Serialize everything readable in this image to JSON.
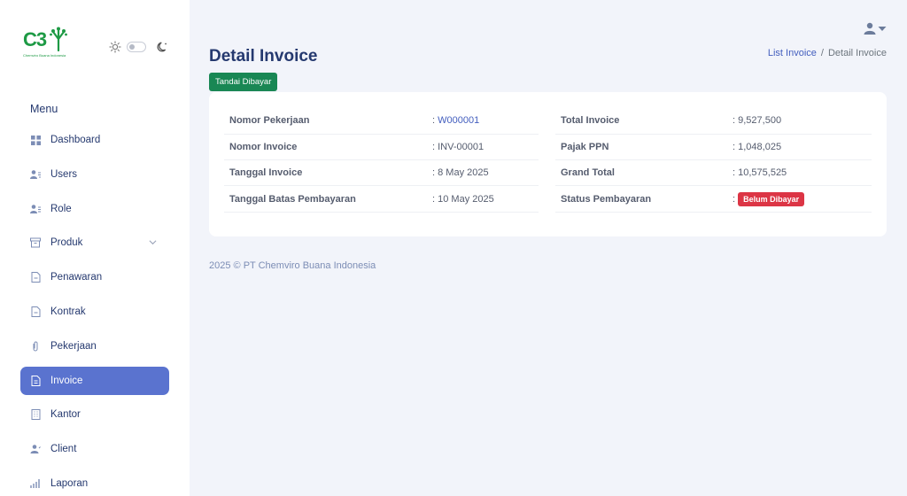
{
  "brand": {
    "logo_text": "C3",
    "tagline": "Chemviro Buana Indonesia"
  },
  "sidebar": {
    "menu_title": "Menu",
    "items": [
      {
        "label": "Dashboard",
        "icon": "grid-icon"
      },
      {
        "label": "Users",
        "icon": "users-icon"
      },
      {
        "label": "Role",
        "icon": "role-icon"
      },
      {
        "label": "Produk",
        "icon": "archive-icon",
        "has_submenu": true
      },
      {
        "label": "Penawaran",
        "icon": "file-icon"
      },
      {
        "label": "Kontrak",
        "icon": "file-minus-icon"
      },
      {
        "label": "Pekerjaan",
        "icon": "paperclip-icon"
      },
      {
        "label": "Invoice",
        "icon": "file-text-icon",
        "active": true
      },
      {
        "label": "Kantor",
        "icon": "building-icon"
      },
      {
        "label": "Client",
        "icon": "person-icon"
      },
      {
        "label": "Laporan",
        "icon": "bar-chart-icon"
      }
    ]
  },
  "header": {
    "title": "Detail Invoice",
    "breadcrumb": {
      "parent": "List Invoice",
      "separator": "/",
      "current": "Detail Invoice"
    }
  },
  "actions": {
    "mark_paid_label": "Tandai Dibayar"
  },
  "invoice": {
    "left": [
      {
        "label": "Nomor Pekerjaan",
        "prefix": ": ",
        "value": "W000001",
        "link": true
      },
      {
        "label": "Nomor Invoice",
        "prefix": ": ",
        "value": "INV-00001"
      },
      {
        "label": "Tanggal Invoice",
        "prefix": ": ",
        "value": "8 May 2025"
      },
      {
        "label": "Tanggal Batas Pembayaran",
        "prefix": ": ",
        "value": "10 May 2025"
      }
    ],
    "right": [
      {
        "label": "Total Invoice",
        "prefix": ": ",
        "value": "9,527,500"
      },
      {
        "label": "Pajak PPN",
        "prefix": ": ",
        "value": "1,048,025"
      },
      {
        "label": "Grand Total",
        "prefix": ": ",
        "value": "10,575,525"
      },
      {
        "label": "Status Pembayaran",
        "prefix": ": ",
        "value": "Belum Dibayar",
        "badge": true
      }
    ]
  },
  "footer": {
    "text": "2025 © PT Chemviro Buana Indonesia"
  },
  "colors": {
    "primary": "#435ebe",
    "active_menu": "#5a73cf",
    "success": "#198754",
    "danger": "#dc3545",
    "brand_green": "#1e9a45"
  }
}
